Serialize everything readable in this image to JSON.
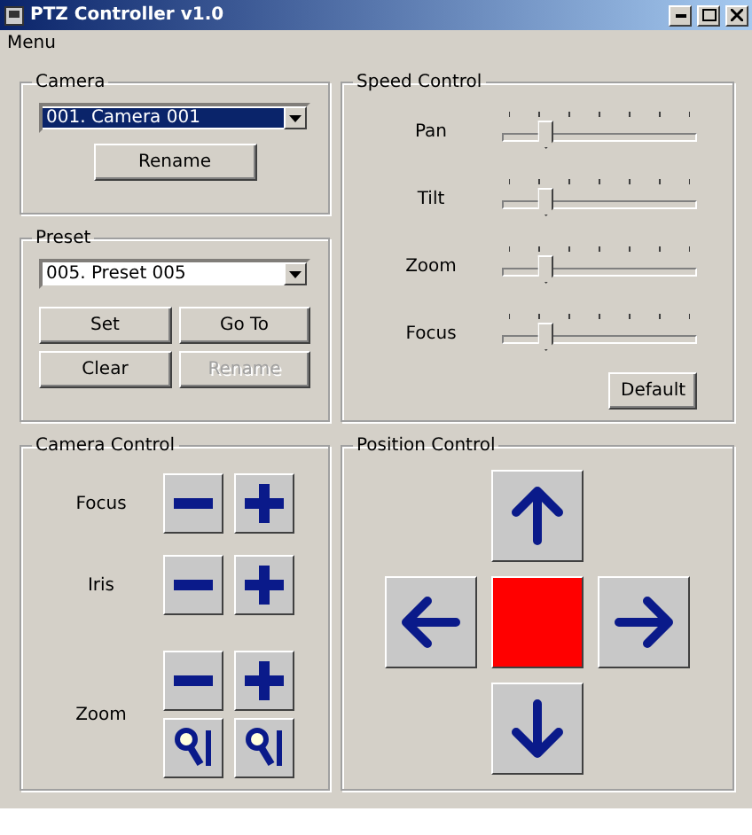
{
  "window": {
    "title": "PTZ Controller v1.0"
  },
  "menu": [
    "Menu"
  ],
  "camera": {
    "title": "Camera",
    "select": {
      "value": "001. Camera 001",
      "focused": true
    },
    "buttons": [
      {
        "label": "Rename",
        "disabled": false
      }
    ]
  },
  "preset": {
    "title": "Preset",
    "select": {
      "value": "005. Preset 005",
      "focused": false
    },
    "buttons": [
      {
        "label": "Set",
        "disabled": false
      },
      {
        "label": "Go To",
        "disabled": false
      },
      {
        "label": "Clear",
        "disabled": false
      },
      {
        "label": "Rename",
        "disabled": true
      }
    ]
  },
  "speed_control": {
    "title": "Speed Control",
    "sliders": [
      {
        "label": "Pan",
        "level": 0.2
      },
      {
        "label": "Tilt",
        "level": 0.2
      },
      {
        "label": "Zoom",
        "level": 0.2
      },
      {
        "label": "Focus",
        "level": 0.2
      }
    ],
    "button": "Default"
  },
  "camera_control": {
    "title": "Camera Control",
    "rows": [
      {
        "label": "Focus",
        "kind": "plusminus"
      },
      {
        "label": "Iris",
        "kind": "plusminus"
      },
      {
        "label": "Zoom",
        "kind": "zoom"
      }
    ]
  },
  "position_control": {
    "title": "Position Control"
  }
}
